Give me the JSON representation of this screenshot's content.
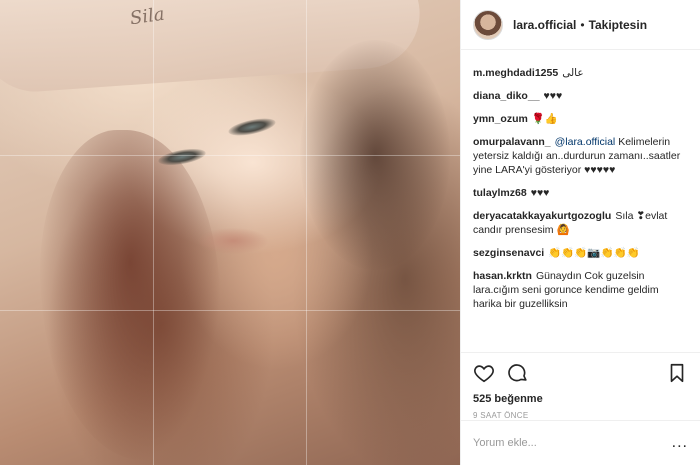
{
  "post": {
    "photo_alt": "Kadın portresi",
    "tattoo_text": "Sila"
  },
  "header": {
    "username": "lara.official",
    "separator": "•",
    "follow_status": "Takiptesin"
  },
  "comments": [
    {
      "user": "m.meghdadi1255",
      "text": "عالی"
    },
    {
      "user": "diana_diko__",
      "text": "♥♥♥"
    },
    {
      "user": "ymn_ozum",
      "text": "🌹👍"
    },
    {
      "user": "omurpalavann_",
      "mention": "@lara.official",
      "text": " Kelimelerin yetersiz kaldığı an..durdurun zamanı..saatler yine LARA'yi gösteriyor ♥♥♥♥♥"
    },
    {
      "user": "tulaylmz68",
      "text": "♥♥♥"
    },
    {
      "user": "deryacatakkayakurtgozoglu",
      "text": "Sıla ❣evlat candır prensesim 🙆"
    },
    {
      "user": "sezginsenavci",
      "text": "👏👏👏📷👏👏👏"
    },
    {
      "user": "hasan.krktn",
      "text": "Günaydın Cok guzelsin lara.cığım seni gorunce kendime geldim harika bir guzelliksin"
    }
  ],
  "actions": {
    "like_icon": "heart-icon",
    "comment_icon": "comment-bubble-icon",
    "save_icon": "bookmark-icon",
    "likes_text": "525 beğenme",
    "time_text": "9 SAAT ÖNCE"
  },
  "add_comment": {
    "placeholder": "Yorum ekle...",
    "more_label": "..."
  }
}
